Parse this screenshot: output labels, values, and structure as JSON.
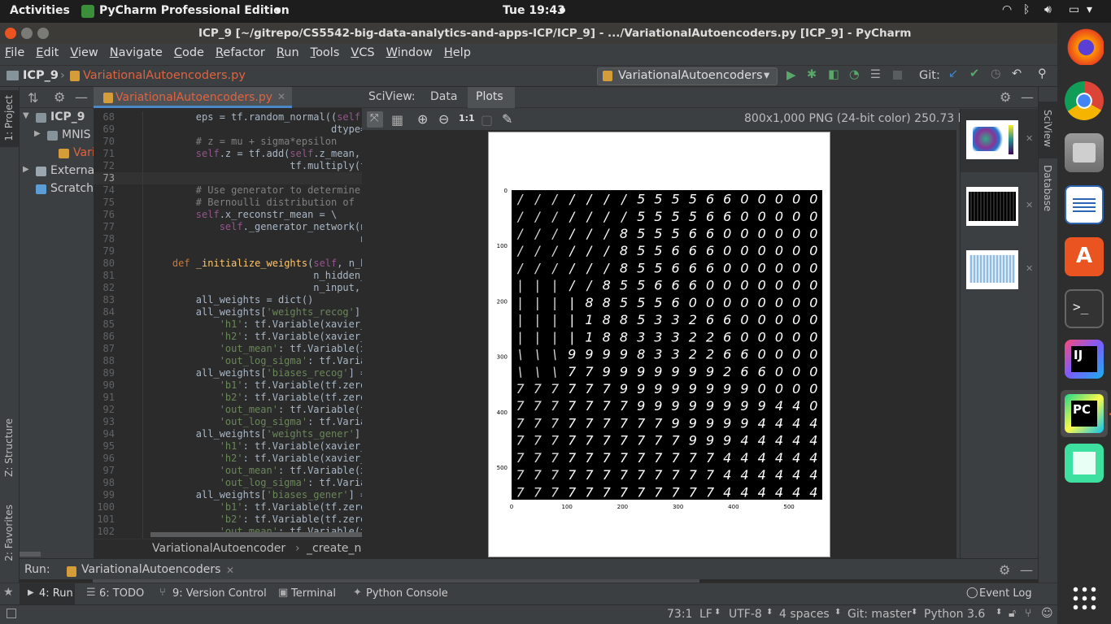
{
  "top_bar": {
    "activities": "Activities",
    "app_name": "PyCharm Professional Edition",
    "clock": "Tue 19:43"
  },
  "window": {
    "title": "ICP_9 [~/gitrepo/CS5542-big-data-analytics-and-apps-ICP/ICP_9] - .../VariationalAutoencoders.py [ICP_9] - PyCharm"
  },
  "menu": [
    "File",
    "Edit",
    "View",
    "Navigate",
    "Code",
    "Refactor",
    "Run",
    "Tools",
    "VCS",
    "Window",
    "Help"
  ],
  "nav": {
    "project": "ICP_9",
    "file": "VariationalAutoencoders.py",
    "run_config": "VariationalAutoencoders",
    "git_label": "Git:"
  },
  "project_tree": [
    {
      "label": "ICP_9",
      "indent": 0,
      "bold": true
    },
    {
      "label": "MNIS",
      "indent": 1
    },
    {
      "label": "Varia",
      "indent": 2,
      "highlight": true
    },
    {
      "label": "Externa",
      "indent": 0
    },
    {
      "label": "Scratche",
      "indent": 0
    }
  ],
  "editor": {
    "tab": "VariationalAutoencoders.py",
    "breadcrumb_class": "VariationalAutoencoder",
    "breadcrumb_method": "_create_ne",
    "lines": [
      {
        "n": "68",
        "t": "        eps = tf.random_normal((self."
      },
      {
        "n": "69",
        "t": "                               dtype="
      },
      {
        "n": "70",
        "t": "        # z = mu + sigma*epsilon"
      },
      {
        "n": "71",
        "t": "        self.z = tf.add(self.z_mean,"
      },
      {
        "n": "72",
        "t": "                        tf.multiply(t"
      },
      {
        "n": "73",
        "t": ""
      },
      {
        "n": "74",
        "t": "        # Use generator to determine m"
      },
      {
        "n": "75",
        "t": "        # Bernoulli distribution of re"
      },
      {
        "n": "76",
        "t": "        self.x_reconstr_mean = \\"
      },
      {
        "n": "77",
        "t": "            self._generator_network(ne"
      },
      {
        "n": "78",
        "t": "                                    ne"
      },
      {
        "n": "79",
        "t": ""
      },
      {
        "n": "80",
        "t": "    def _initialize_weights(self, n_hi"
      },
      {
        "n": "81",
        "t": "                            n_hidden_g"
      },
      {
        "n": "82",
        "t": "                            n_input, n"
      },
      {
        "n": "83",
        "t": "        all_weights = dict()"
      },
      {
        "n": "84",
        "t": "        all_weights['weights_recog'] ="
      },
      {
        "n": "85",
        "t": "            'h1': tf.Variable(xavier_i"
      },
      {
        "n": "86",
        "t": "            'h2': tf.Variable(xavier_i"
      },
      {
        "n": "87",
        "t": "            'out_mean': tf.Variable(xa"
      },
      {
        "n": "88",
        "t": "            'out_log_sigma': tf.Variab"
      },
      {
        "n": "89",
        "t": "        all_weights['biases_recog'] = "
      },
      {
        "n": "90",
        "t": "            'b1': tf.Variable(tf.zeros"
      },
      {
        "n": "91",
        "t": "            'b2': tf.Variable(tf.zeros"
      },
      {
        "n": "92",
        "t": "            'out_mean': tf.Variable(tf"
      },
      {
        "n": "93",
        "t": "            'out_log_sigma': tf.Variab"
      },
      {
        "n": "94",
        "t": "        all_weights['weights_gener'] ="
      },
      {
        "n": "95",
        "t": "            'h1': tf.Variable(xavier_i"
      },
      {
        "n": "96",
        "t": "            'h2': tf.Variable(xavier_i"
      },
      {
        "n": "97",
        "t": "            'out_mean': tf.Variable(xa"
      },
      {
        "n": "98",
        "t": "            'out_log_sigma': tf.Varia"
      },
      {
        "n": "99",
        "t": "        all_weights['biases_gener'] ="
      },
      {
        "n": "100",
        "t": "            'b1': tf.Variable(tf.zeros"
      },
      {
        "n": "101",
        "t": "            'b2': tf.Variable(tf.zeros"
      },
      {
        "n": "102",
        "t": "            'out_mean': tf.Variable(tf"
      }
    ]
  },
  "sciview": {
    "label": "SciView:",
    "tab_data": "Data",
    "tab_plots": "Plots",
    "zoom_label": "1:1",
    "image_info": "800x1,000 PNG (24-bit color) 250.73 kB",
    "y_ticks": [
      "0",
      "100",
      "200",
      "300",
      "400",
      "500"
    ],
    "x_ticks": [
      "0",
      "100",
      "200",
      "300",
      "400",
      "500"
    ],
    "grid_rows": [
      "/ / / / / / / 5 5 5 5 6 6 0 0 0 0 0",
      "/ / / / / / / 5 5 5 5 6 6 0 0 0 0 0",
      "/ / / / / / 8 5 5 5 6 6 0 0 0 0 0 0",
      "/ / / / / / 8 5 5 6 6 6 0 0 0 0 0 0",
      "/ / / / / / 8 5 5 6 6 6 0 0 0 0 0 0",
      "| | | / / 8 5 5 6 6 6 0 0 0 0 0 0 0",
      "| | | | 8 8 5 5 5 6 0 0 0 0 0 0 0 0",
      "| | | | 1 8 8 5 3 3 2 6 6 0 0 0 0 0",
      "| | | | 1 8 8 3 3 3 2 2 6 0 0 0 0 0",
      "\\ \\ \\ 9 9 9 9 8 3 3 2 2 6 6 0 0 0 0",
      "\\ \\ \\ 7 7 9 9 9 9 9 9 9 2 6 6 0 0 0",
      "7 7 7 7 7 7 9 9 9 9 9 9 9 9 0 0 0 0",
      "7 7 7 7 7 7 7 9 9 9 9 9 9 9 9 4 4 0",
      "7 7 7 7 7 7 7 7 7 9 9 9 9 9 4 4 4 4",
      "7 7 7 7 7 7 7 7 7 7 9 9 9 4 4 4 4 4",
      "7 7 7 7 7 7 7 7 7 7 7 7 4 4 4 4 4 4",
      "7 7 7 7 7 7 7 7 7 7 7 7 4 4 4 4 4 4",
      "7 7 7 7 7 7 7 7 7 7 7 7 4 4 4 4 4 4"
    ],
    "side_tabs": [
      "SciView",
      "Database"
    ]
  },
  "run": {
    "label": "Run:",
    "tab": "VariationalAutoencoders"
  },
  "bottom_tabs": [
    {
      "key": "4",
      "label": "4: Run"
    },
    {
      "key": "6",
      "label": "6: TODO"
    },
    {
      "key": "9",
      "label": "9: Version Control"
    },
    {
      "key": "t",
      "label": "Terminal"
    },
    {
      "key": "p",
      "label": "Python Console"
    }
  ],
  "event_log": "Event Log",
  "status": {
    "position": "73:1",
    "line_sep": "LF",
    "encoding": "UTF-8",
    "indent": "4 spaces",
    "git": "Git: master",
    "interpreter": "Python 3.6"
  },
  "left_tabs": [
    "1: Project",
    "Z: Structure",
    "2: Favorites"
  ],
  "dock_apps": [
    "firefox",
    "chrome",
    "file-manager",
    "writer",
    "software",
    "terminal",
    "intellij",
    "pycharm",
    "app",
    "app-grid"
  ]
}
